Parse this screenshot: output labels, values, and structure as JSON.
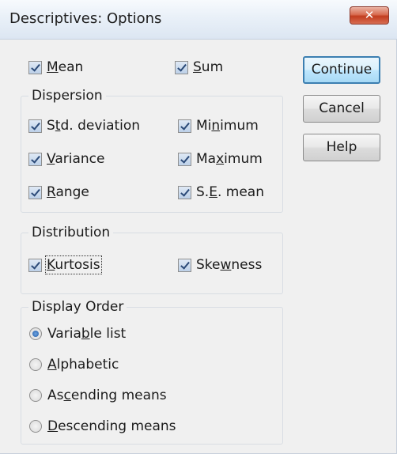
{
  "window": {
    "title": "Descriptives: Options",
    "close_glyph": "✕"
  },
  "top": {
    "mean": {
      "pre": "",
      "u": "M",
      "post": "ean",
      "checked": true
    },
    "sum": {
      "pre": "",
      "u": "S",
      "post": "um",
      "checked": true
    }
  },
  "dispersion": {
    "label": "Dispersion",
    "std_deviation": {
      "pre": "S",
      "u": "t",
      "post": "d. deviation",
      "checked": true
    },
    "minimum": {
      "pre": "Mi",
      "u": "n",
      "post": "imum",
      "checked": true
    },
    "variance": {
      "pre": "",
      "u": "V",
      "post": "ariance",
      "checked": true
    },
    "maximum": {
      "pre": "Ma",
      "u": "x",
      "post": "imum",
      "checked": true
    },
    "range": {
      "pre": "",
      "u": "R",
      "post": "ange",
      "checked": true
    },
    "se_mean": {
      "pre": "S.",
      "u": "E",
      "post": ". mean",
      "checked": true
    }
  },
  "distribution": {
    "label": "Distribution",
    "kurtosis": {
      "pre": "",
      "u": "K",
      "post": "urtosis",
      "checked": true
    },
    "skewness": {
      "pre": "Ske",
      "u": "w",
      "post": "ness",
      "checked": true
    }
  },
  "display_order": {
    "label": "Display Order",
    "variable_list": {
      "pre": "Varia",
      "u": "b",
      "post": "le list",
      "selected": true
    },
    "alphabetic": {
      "pre": "",
      "u": "A",
      "post": "lphabetic",
      "selected": false
    },
    "ascending": {
      "pre": "As",
      "u": "c",
      "post": "ending means",
      "selected": false
    },
    "descending": {
      "pre": "",
      "u": "D",
      "post": "escending means",
      "selected": false
    }
  },
  "buttons": {
    "continue": "Continue",
    "cancel": "Cancel",
    "help": "Help"
  }
}
